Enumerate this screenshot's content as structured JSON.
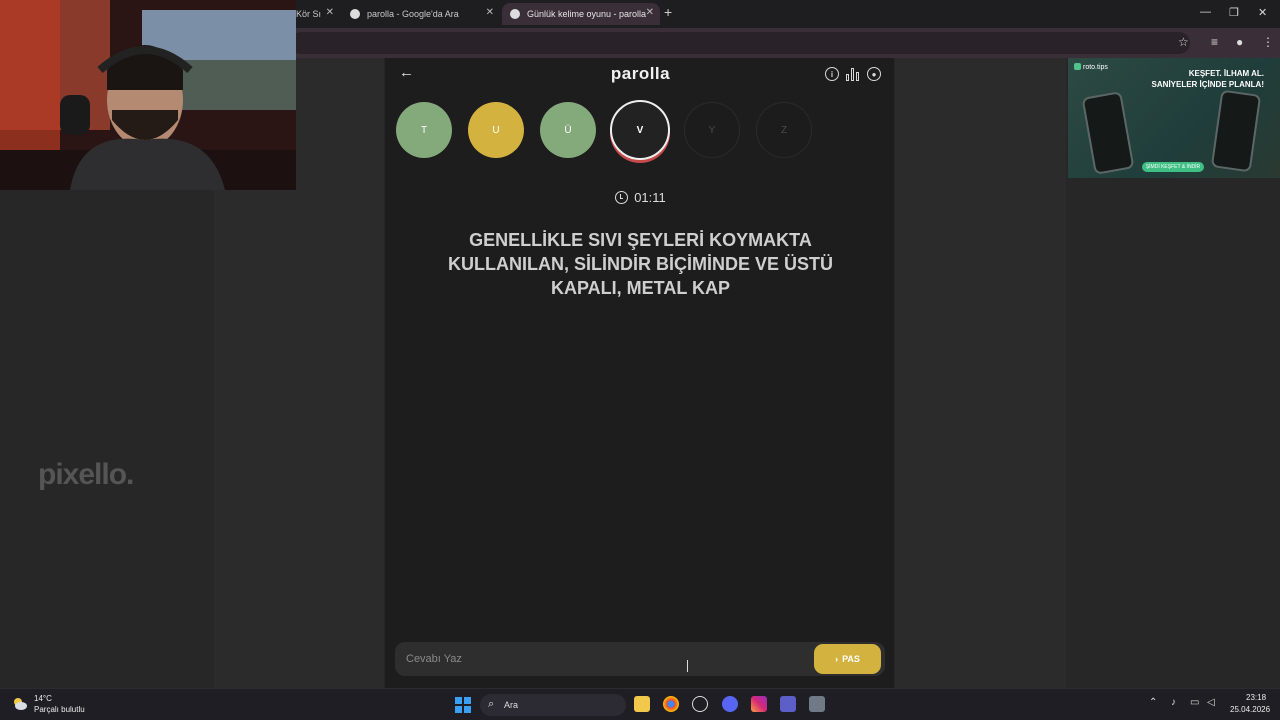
{
  "browser": {
    "tabs": [
      {
        "title": "Kör Sı",
        "active": false
      },
      {
        "title": "parolla - Google'da Ara",
        "active": false
      },
      {
        "title": "Günlük kelime oyunu - parolla",
        "active": true
      }
    ],
    "new_tab_label": "+",
    "close_glyph": "✕"
  },
  "app": {
    "logo": "parolla",
    "back_icon": "arrow-left-icon",
    "header_icons": [
      "info-icon",
      "stats-icon",
      "user-icon"
    ],
    "letters": [
      {
        "label": "T",
        "state": "correct"
      },
      {
        "label": "U",
        "state": "passed"
      },
      {
        "label": "Ü",
        "state": "correct"
      },
      {
        "label": "V",
        "state": "current"
      },
      {
        "label": "Y",
        "state": "pending"
      },
      {
        "label": "Z",
        "state": "pending"
      }
    ],
    "timer": "01:11",
    "question": "GENELLİKLE SIVI ŞEYLERİ KOYMAKTA KULLANILAN, SİLİNDİR BİÇİMİNDE VE ÜSTÜ KAPALI, METAL KAP",
    "answer_placeholder": "Cevabı Yaz",
    "pass_label": "PAS",
    "colors": {
      "correct": "#84a97b",
      "passed": "#d3b23f",
      "current_ring": "#c74a4a"
    }
  },
  "sidebar_watermark": "pixello.",
  "ad": {
    "brand": "roto.tips",
    "headline_1": "KEŞFET. İLHAM AL.",
    "headline_2": "SANİYELER İÇİNDE PLANLA!",
    "cta": "ŞİMDİ KEŞFET & İNDİR"
  },
  "taskbar": {
    "weather_temp": "14°C",
    "weather_desc": "Parçalı bulutlu",
    "search_label": "Ara",
    "time": "23:18",
    "date": "25.04.2026"
  }
}
